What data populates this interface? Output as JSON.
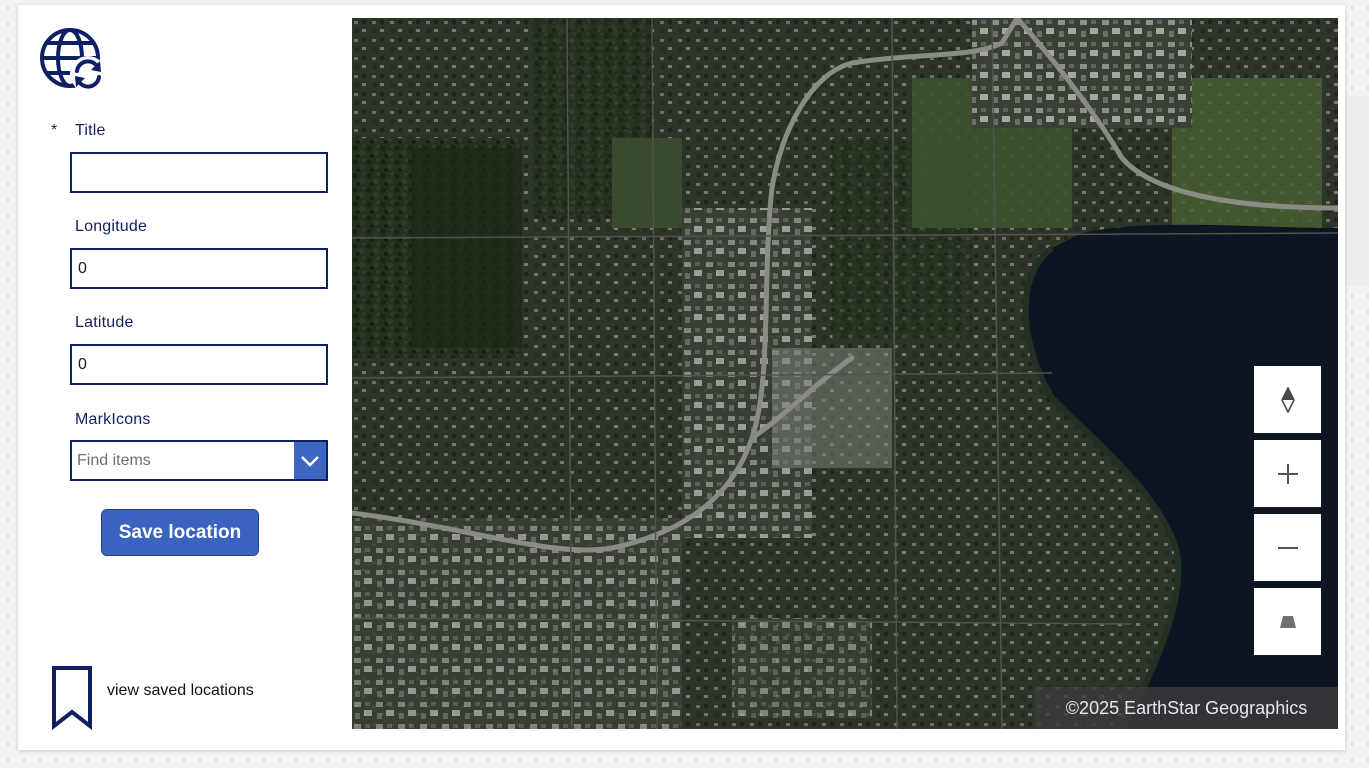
{
  "form": {
    "title_required_marker": "*",
    "title_label": "Title",
    "title_value": "",
    "longitude_label": "Longitude",
    "longitude_value": "0",
    "latitude_label": "Latitude",
    "latitude_value": "0",
    "markicons_label": "MarkIcons",
    "markicons_placeholder": "Find items",
    "save_label": "Save location"
  },
  "saved_link_label": "view saved locations",
  "map": {
    "attribution": "©2025 EarthStar Geographics",
    "controls": [
      "compass-icon",
      "zoom-in-icon",
      "zoom-out-icon",
      "pitch-icon"
    ]
  },
  "colors": {
    "accent_navy": "#0f1f63",
    "button_blue": "#3a64c0",
    "dropdown_blue": "#3f65c5",
    "map_water": "#0c1521"
  },
  "icons": {
    "logo": "globe-sync-icon",
    "saved": "bookmark-icon",
    "dropdown": "chevron-down-icon"
  }
}
